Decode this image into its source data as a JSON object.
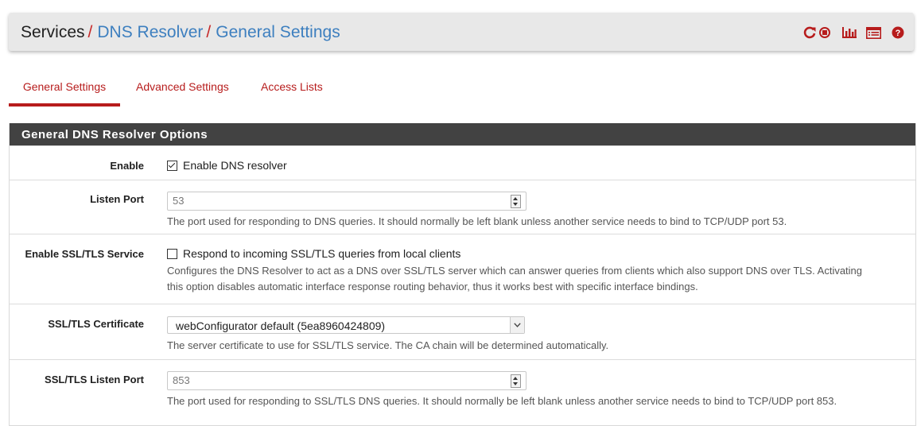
{
  "breadcrumb": {
    "services": "Services",
    "separator": "/",
    "dns_resolver": "DNS Resolver",
    "general_settings": "General Settings"
  },
  "header_icons": [
    "restart-icon",
    "stop-icon",
    "status-graph-icon",
    "log-icon",
    "help-icon"
  ],
  "colors": {
    "accent": "#b71c1c",
    "link": "#3d7fbf",
    "panel_heading": "#424242"
  },
  "tabs": [
    {
      "label": "General Settings",
      "active": true
    },
    {
      "label": "Advanced Settings",
      "active": false
    },
    {
      "label": "Access Lists",
      "active": false
    }
  ],
  "panel": {
    "title": "General DNS Resolver Options",
    "rows": {
      "enable": {
        "label": "Enable",
        "checkbox_label": "Enable DNS resolver",
        "checked": true
      },
      "listen_port": {
        "label": "Listen Port",
        "placeholder": "53",
        "help": "The port used for responding to DNS queries. It should normally be left blank unless another service needs to bind to TCP/UDP port 53."
      },
      "ssl_service": {
        "label": "Enable SSL/TLS Service",
        "checkbox_label": "Respond to incoming SSL/TLS queries from local clients",
        "checked": false,
        "help_line1": "Configures the DNS Resolver to act as a DNS over SSL/TLS server which can answer queries from clients which also support DNS over TLS. Activating",
        "help_line2": "this option disables automatic interface response routing behavior, thus it works best with specific interface bindings."
      },
      "ssl_certificate": {
        "label": "SSL/TLS Certificate",
        "selected": "webConfigurator default (5ea8960424809)",
        "help": "The server certificate to use for SSL/TLS service. The CA chain will be determined automatically."
      },
      "ssl_listen_port": {
        "label": "SSL/TLS Listen Port",
        "placeholder": "853",
        "help": "The port used for responding to SSL/TLS DNS queries. It should normally be left blank unless another service needs to bind to TCP/UDP port 853."
      }
    }
  }
}
